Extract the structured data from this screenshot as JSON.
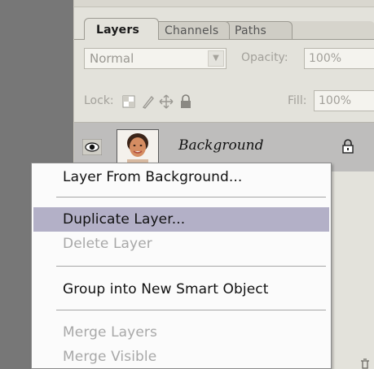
{
  "panel": {
    "tabs": [
      {
        "label": "Layers",
        "active": true
      },
      {
        "label": "Channels",
        "active": false
      },
      {
        "label": "Paths",
        "active": false
      }
    ],
    "blend_mode": "Normal",
    "opacity_label": "Opacity:",
    "opacity_value": "100%",
    "lock_label": "Lock:",
    "fill_label": "Fill:",
    "fill_value": "100%",
    "layer": {
      "name": "Background",
      "visible": true,
      "locked": true
    }
  },
  "context_menu": {
    "items": [
      {
        "label": "Layer From Background...",
        "enabled": true,
        "highlighted": false
      },
      {
        "label": "Duplicate Layer...",
        "enabled": true,
        "highlighted": true
      },
      {
        "label": "Delete Layer",
        "enabled": false,
        "highlighted": false
      },
      {
        "label": "Group into New Smart Object",
        "enabled": true,
        "highlighted": false
      },
      {
        "label": "Merge Layers",
        "enabled": false,
        "highlighted": false
      },
      {
        "label": "Merge Visible",
        "enabled": false,
        "highlighted": false
      }
    ]
  },
  "colors": {
    "highlight": "#b3b0c7",
    "panel_bg": "#e3e2db",
    "selected_layer_bg": "#bebdbc",
    "canvas_bg": "#777777"
  }
}
